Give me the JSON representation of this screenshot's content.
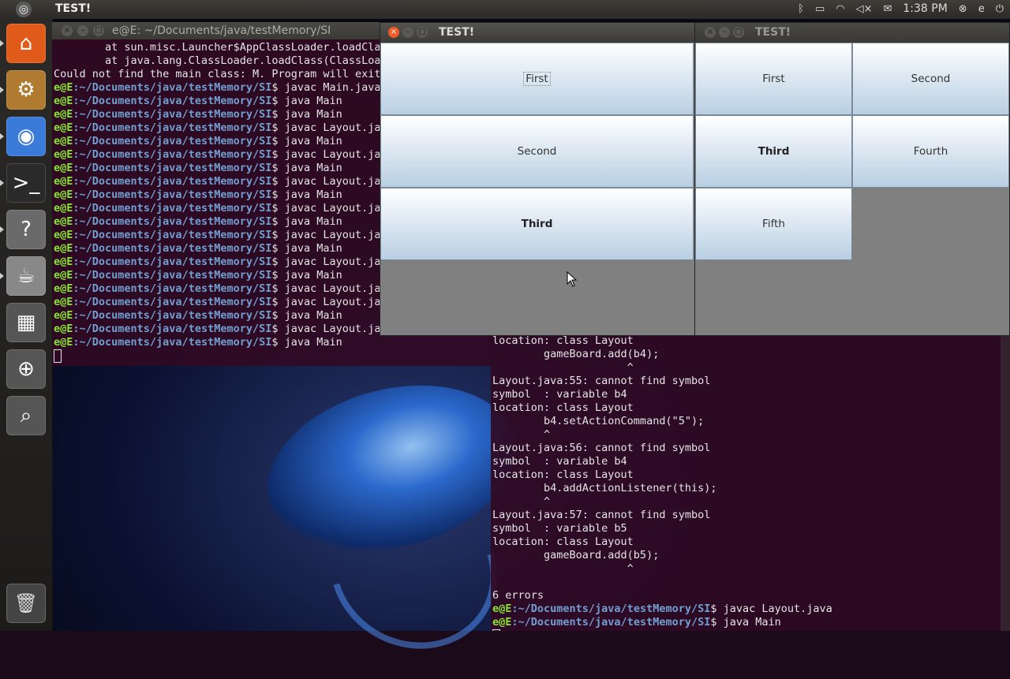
{
  "topbar": {
    "app_title": "TEST!",
    "clock": "1:38 PM",
    "user": "e",
    "icons": [
      "bluetooth-icon",
      "battery-icon",
      "wifi-icon",
      "volume-mute-icon",
      "mail-icon",
      "user-icon",
      "power-icon"
    ]
  },
  "launcher": {
    "items": [
      {
        "name": "home-folder-icon",
        "glyph": "⌂",
        "color": "#e05a1a"
      },
      {
        "name": "software-center-icon",
        "glyph": "⚙",
        "color": "#b07a30"
      },
      {
        "name": "chrome-icon",
        "glyph": "◉",
        "color": "#3a7ad8"
      },
      {
        "name": "terminal-icon",
        "glyph": ">_",
        "color": "#2a2a2a"
      },
      {
        "name": "help-icon",
        "glyph": "?",
        "color": "#6a6a6a"
      },
      {
        "name": "java-icon",
        "glyph": "☕",
        "color": "#888"
      },
      {
        "name": "workspace-switcher-icon",
        "glyph": "▦",
        "color": "#555"
      },
      {
        "name": "magnifier-icon",
        "glyph": "⊕",
        "color": "#555"
      },
      {
        "name": "search-files-icon",
        "glyph": "⌕",
        "color": "#555"
      }
    ],
    "trash": "trash-icon"
  },
  "terminal1": {
    "title": "e@E: ~/Documents/java/testMemory/SI",
    "prompt_user": "e@E",
    "prompt_path": ":~/Documents/java/testMemory/SI",
    "lines": [
      {
        "plain": "        at sun.misc.Launcher$AppClassLoader.loadClas"
      },
      {
        "plain": "        at java.lang.ClassLoader.loadClass(ClassLoad"
      },
      {
        "plain": "Could not find the main class: M. Program will exit."
      },
      {
        "cmd": "$ javac Main.java"
      },
      {
        "cmd": "$ java Main"
      },
      {
        "cmd": "$ java Main"
      },
      {
        "cmd": "$ javac Layout.java"
      },
      {
        "cmd": "$ java Main"
      },
      {
        "cmd": "$ javac Layout.java"
      },
      {
        "cmd": "$ java Main"
      },
      {
        "cmd": "$ javac Layout.java"
      },
      {
        "cmd": "$ java Main"
      },
      {
        "cmd": "$ javac Layout.java"
      },
      {
        "cmd": "$ java Main"
      },
      {
        "cmd": "$ javac Layout.java"
      },
      {
        "cmd": "$ java Main"
      },
      {
        "cmd": "$ javac Layout.java"
      },
      {
        "cmd": "$ java Main"
      },
      {
        "cmd": "$ javac Layout.java"
      },
      {
        "cmd": "$ javac Layout.java"
      },
      {
        "cmd": "$ java Main"
      },
      {
        "cmd": "$ javac Layout.java"
      },
      {
        "cmd": "$ java Main"
      }
    ]
  },
  "terminal2": {
    "prompt_user": "e@E",
    "prompt_path": ":~/Documents/java/testMemory/SI",
    "lines": [
      {
        "plain": "location: class Layout"
      },
      {
        "plain": "        gameBoard.add(b4);"
      },
      {
        "plain": "                     ^"
      },
      {
        "plain": "Layout.java:55: cannot find symbol"
      },
      {
        "plain": "symbol  : variable b4"
      },
      {
        "plain": "location: class Layout"
      },
      {
        "plain": "        b4.setActionCommand(\"5\");"
      },
      {
        "plain": "        ^"
      },
      {
        "plain": "Layout.java:56: cannot find symbol"
      },
      {
        "plain": "symbol  : variable b4"
      },
      {
        "plain": "location: class Layout"
      },
      {
        "plain": "        b4.addActionListener(this);"
      },
      {
        "plain": "        ^"
      },
      {
        "plain": "Layout.java:57: cannot find symbol"
      },
      {
        "plain": "symbol  : variable b5"
      },
      {
        "plain": "location: class Layout"
      },
      {
        "plain": "        gameBoard.add(b5);"
      },
      {
        "plain": "                     ^"
      },
      {
        "plain": ""
      },
      {
        "plain": "6 errors"
      },
      {
        "cmd": "$ javac Layout.java"
      },
      {
        "cmd": "$ java Main"
      }
    ]
  },
  "java_window1": {
    "title": "TEST!",
    "buttons": [
      "First",
      "Second",
      "Third"
    ]
  },
  "java_window2": {
    "title": "TEST!",
    "buttons": [
      "First",
      "Second",
      "Third",
      "Fourth",
      "Fifth"
    ]
  }
}
